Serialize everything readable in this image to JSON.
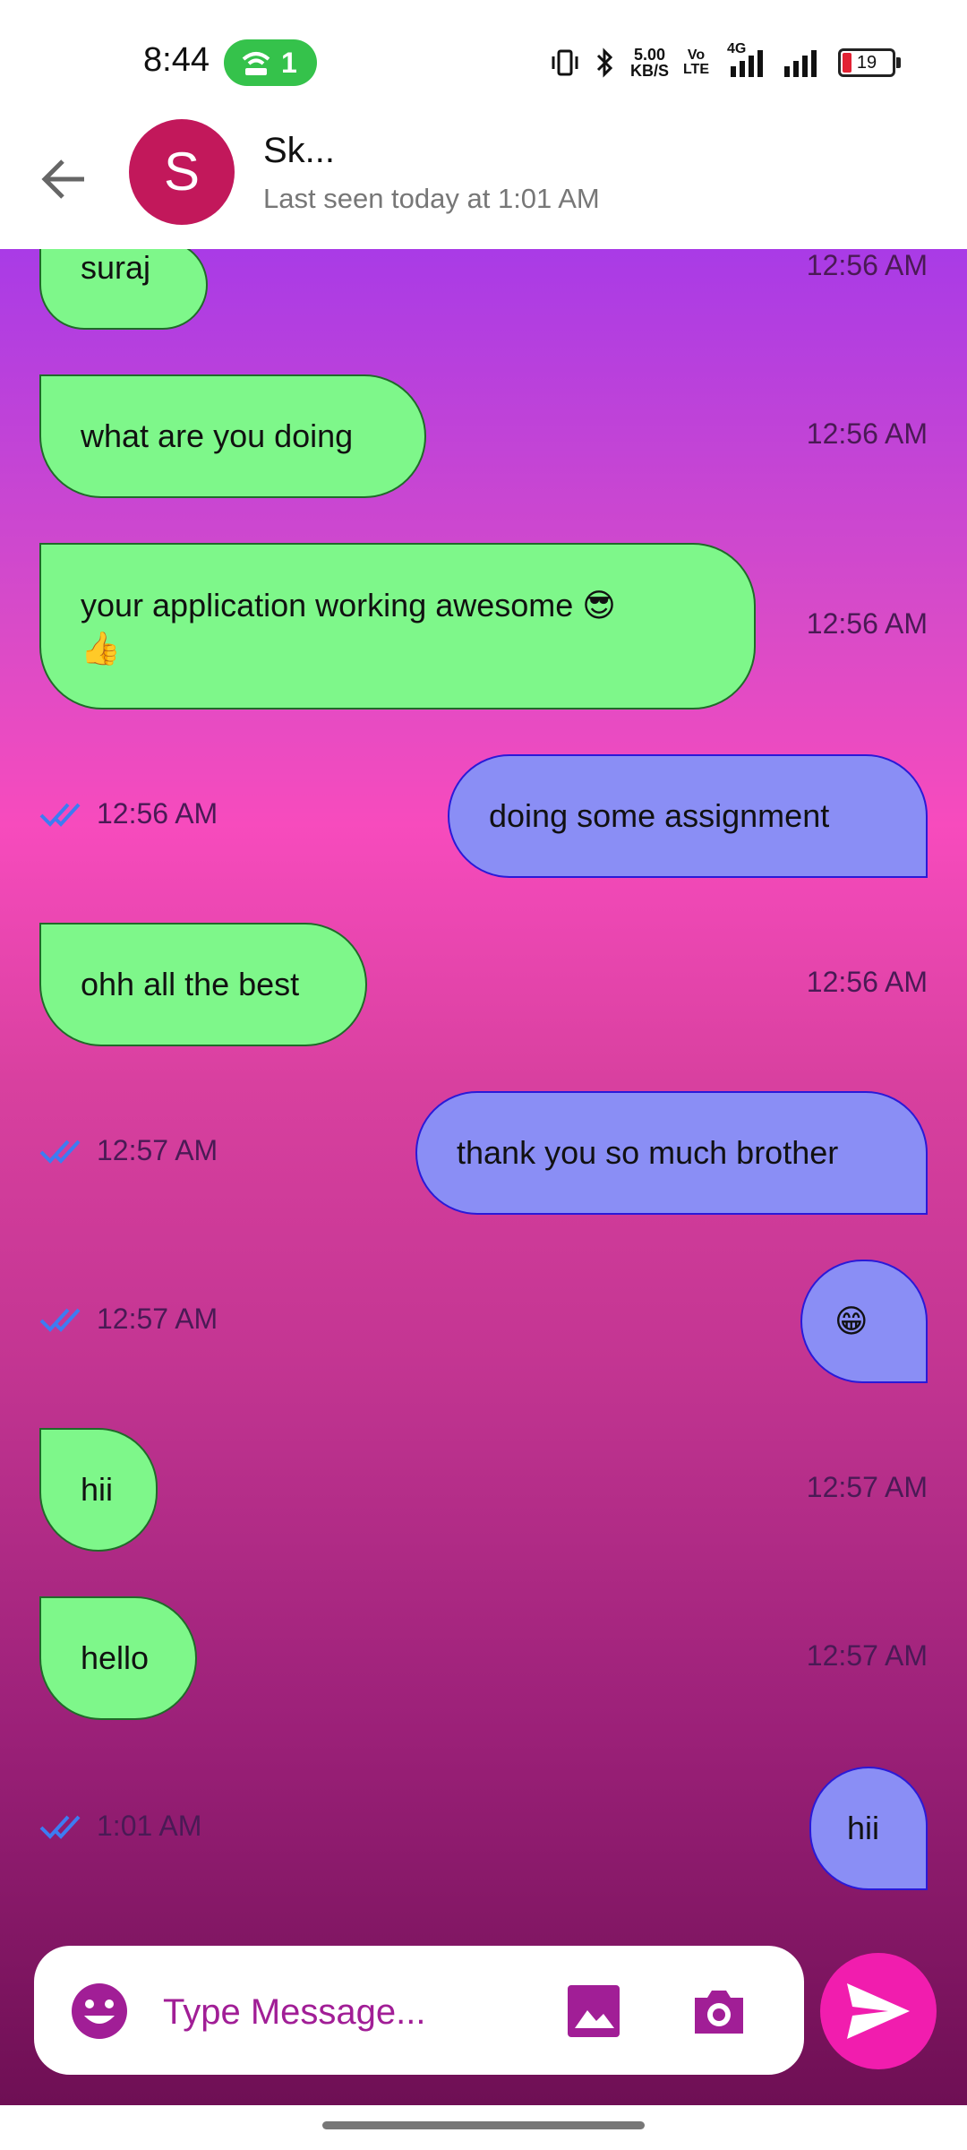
{
  "status_bar": {
    "time": "8:44",
    "hotspot_count": "1",
    "net_speed_value": "5.00",
    "net_speed_unit": "KB/S",
    "volte_top": "Vo",
    "volte_bottom": "LTE",
    "network_type": "4G",
    "battery_level": "19",
    "battery_color": "#e22233"
  },
  "header": {
    "avatar_letter": "S",
    "contact_name": "Sk...",
    "last_seen": "Last seen today at 1:01 AM",
    "avatar_color": "#c2185b"
  },
  "messages": [
    {
      "direction": "in",
      "text": "suraj",
      "time": "12:56 AM"
    },
    {
      "direction": "in",
      "text": "what are you doing",
      "time": "12:56 AM"
    },
    {
      "direction": "in",
      "text_line1": "your application working awesome 😎",
      "text_line2": "👍",
      "time": "12:56 AM"
    },
    {
      "direction": "out",
      "text": "doing some assignment",
      "time": "12:56 AM"
    },
    {
      "direction": "in",
      "text": "ohh all the best",
      "time": "12:56 AM"
    },
    {
      "direction": "out",
      "text": "thank you so much brother",
      "time": "12:57 AM"
    },
    {
      "direction": "out",
      "text": "😁",
      "time": "12:57 AM"
    },
    {
      "direction": "in",
      "text": "hii",
      "time": "12:57 AM"
    },
    {
      "direction": "in",
      "text": "hello",
      "time": "12:57 AM"
    },
    {
      "direction": "out",
      "text": "hii",
      "time": "1:01 AM"
    }
  ],
  "composer": {
    "placeholder": "Type Message...",
    "accent_color": "#a11e96",
    "send_color": "#f11dae"
  },
  "colors": {
    "incoming_bubble": "#7ef78a",
    "outgoing_bubble": "#8a8ef5",
    "read_ticks": "#3d7cf2"
  }
}
